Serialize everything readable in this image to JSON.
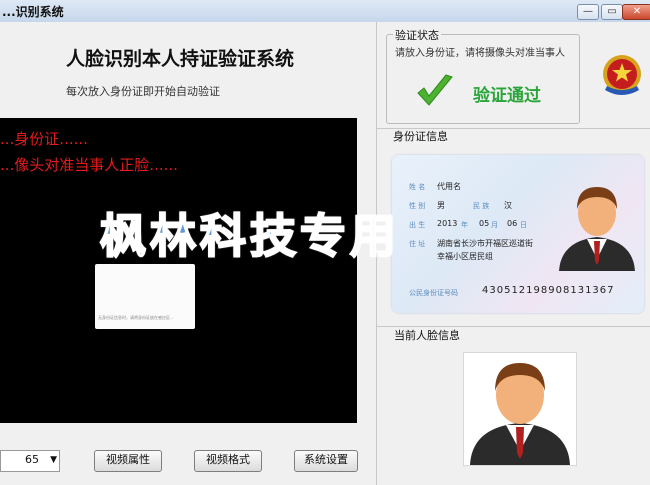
{
  "window": {
    "title": "...识别系统"
  },
  "header": {
    "title": "人脸识别本人持证验证系统",
    "subtitle": "每次放入身份证即开始自动验证"
  },
  "video": {
    "lines": [
      "...身份证......",
      "...像头对准当事人正脸......"
    ],
    "card_text": "无身份证信息时，请将身份证放在感应区..."
  },
  "controls": {
    "combo_value": "65",
    "btn_video_props": "视频属性",
    "btn_video_format": "视频格式",
    "btn_settings": "系统设置"
  },
  "status": {
    "label": "验证状态",
    "message": "请放入身份证，请将摄像头对准当事人",
    "result": "验证通过",
    "result_color": "#2aa53a"
  },
  "id_section": {
    "label": "身份证信息"
  },
  "id_card": {
    "name_label": "姓 名",
    "name": "代用名",
    "gender_label": "性 别",
    "gender": "男",
    "ethnicity_label": "民 族",
    "ethnicity": "汉",
    "birth_label": "出 生",
    "birth_year": "2013",
    "birth_month": "05",
    "birth_day": "06",
    "year_unit": "年",
    "month_unit": "月",
    "day_unit": "日",
    "address_label": "住 址",
    "address_line1": "湖南省长沙市开福区巡道街",
    "address_line2": "幸福小区居民组",
    "id_label": "公民身份证号码",
    "id_number": "430512198908131367"
  },
  "face_section": {
    "label": "当前人脸信息"
  },
  "watermark": "枫林科技专用",
  "window_buttons": {
    "min": "—",
    "max": "▭",
    "close": "✕"
  }
}
